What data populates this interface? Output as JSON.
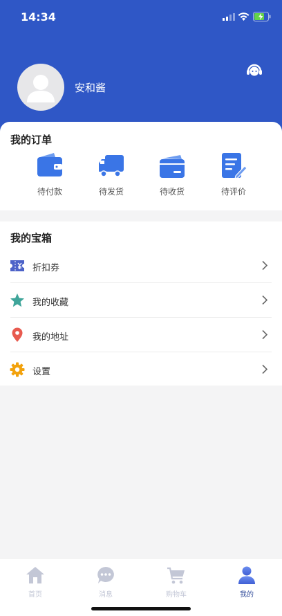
{
  "status": {
    "time": "14:34"
  },
  "profile": {
    "username": "安和酱"
  },
  "orders": {
    "title": "我的订单",
    "items": [
      {
        "label": "待付款",
        "icon": "wallet-icon"
      },
      {
        "label": "待发货",
        "icon": "delivery-truck-icon"
      },
      {
        "label": "待收货",
        "icon": "card-icon"
      },
      {
        "label": "待评价",
        "icon": "edit-review-icon"
      }
    ]
  },
  "treasure": {
    "title": "我的宝箱",
    "items": [
      {
        "label": "折扣券",
        "icon": "coupon-icon"
      },
      {
        "label": "我的收藏",
        "icon": "star-icon"
      },
      {
        "label": "我的地址",
        "icon": "location-pin-icon"
      },
      {
        "label": "设置",
        "icon": "gear-icon"
      }
    ]
  },
  "tabbar": {
    "items": [
      {
        "label": "首页",
        "icon": "home-icon"
      },
      {
        "label": "消息",
        "icon": "message-icon"
      },
      {
        "label": "购物车",
        "icon": "cart-icon"
      },
      {
        "label": "我的",
        "icon": "user-icon"
      }
    ],
    "active_index": 3
  },
  "colors": {
    "header": "#2f57c6",
    "accent": "#3a75e6",
    "tab_active": "#334d9b",
    "tab_inactive": "#c3c7d6"
  }
}
